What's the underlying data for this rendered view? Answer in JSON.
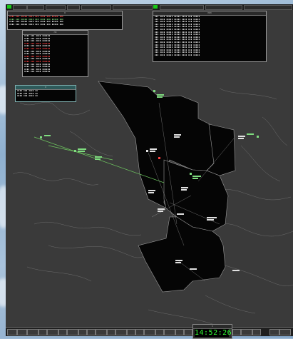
{
  "clock": {
    "time": "14:52:26"
  },
  "colors": {
    "sector": "#050505",
    "route": "#7cdc6e",
    "coastline": "#8a8a8a",
    "clock_digits": "#33ff33",
    "alert": "#ff4040"
  }
}
